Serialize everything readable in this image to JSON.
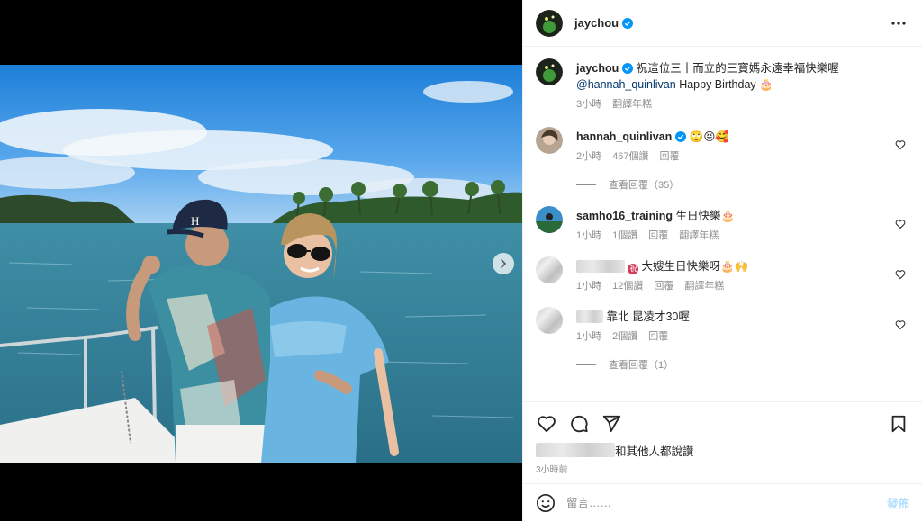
{
  "post": {
    "author": "jaychou",
    "more_icon": "more-horizontal-icon"
  },
  "caption": {
    "author": "jaychou",
    "text": "祝這位三十而立的三寶媽永遠幸福快樂喔",
    "mention": "@hannah_quinlivan",
    "text2": "Happy Birthday",
    "emoji": "🎂",
    "time": "3小時",
    "translate": "翻譯年糕"
  },
  "comments": [
    {
      "username": "hannah_quinlivan",
      "verified": true,
      "text": "🙄😝🥰",
      "time": "2小時",
      "likes": "467個讚",
      "reply": "回覆",
      "replies": "查看回覆（35）"
    },
    {
      "username": "samho16_training",
      "verified": false,
      "text": "生日快樂🎂",
      "time": "1小時",
      "likes": "1個讚",
      "reply": "回覆",
      "translate": "翻譯年糕"
    },
    {
      "username": "",
      "blurred": true,
      "text": "大嫂生日快樂呀🎂🙌",
      "time": "1小時",
      "likes": "12個讚",
      "reply": "回覆",
      "translate": "翻譯年糕"
    },
    {
      "username": "",
      "blurred": true,
      "text": "靠北 昆凌才30喔",
      "time": "1小時",
      "likes": "2個讚",
      "reply": "回覆",
      "replies": "查看回覆（1）"
    }
  ],
  "actions": {
    "like_icon": "heart-icon",
    "comment_icon": "comment-icon",
    "share_icon": "share-icon",
    "save_icon": "bookmark-icon"
  },
  "likes_text": "和其他人都說讚",
  "post_time": "3小時前",
  "composer": {
    "placeholder": "留言……",
    "post_label": "發佈",
    "emoji_icon": "smiley-icon"
  },
  "colors": {
    "verified": "#0095f6",
    "link": "#00376b",
    "muted": "#8e8e8e",
    "post_disabled": "#b2dffc"
  }
}
